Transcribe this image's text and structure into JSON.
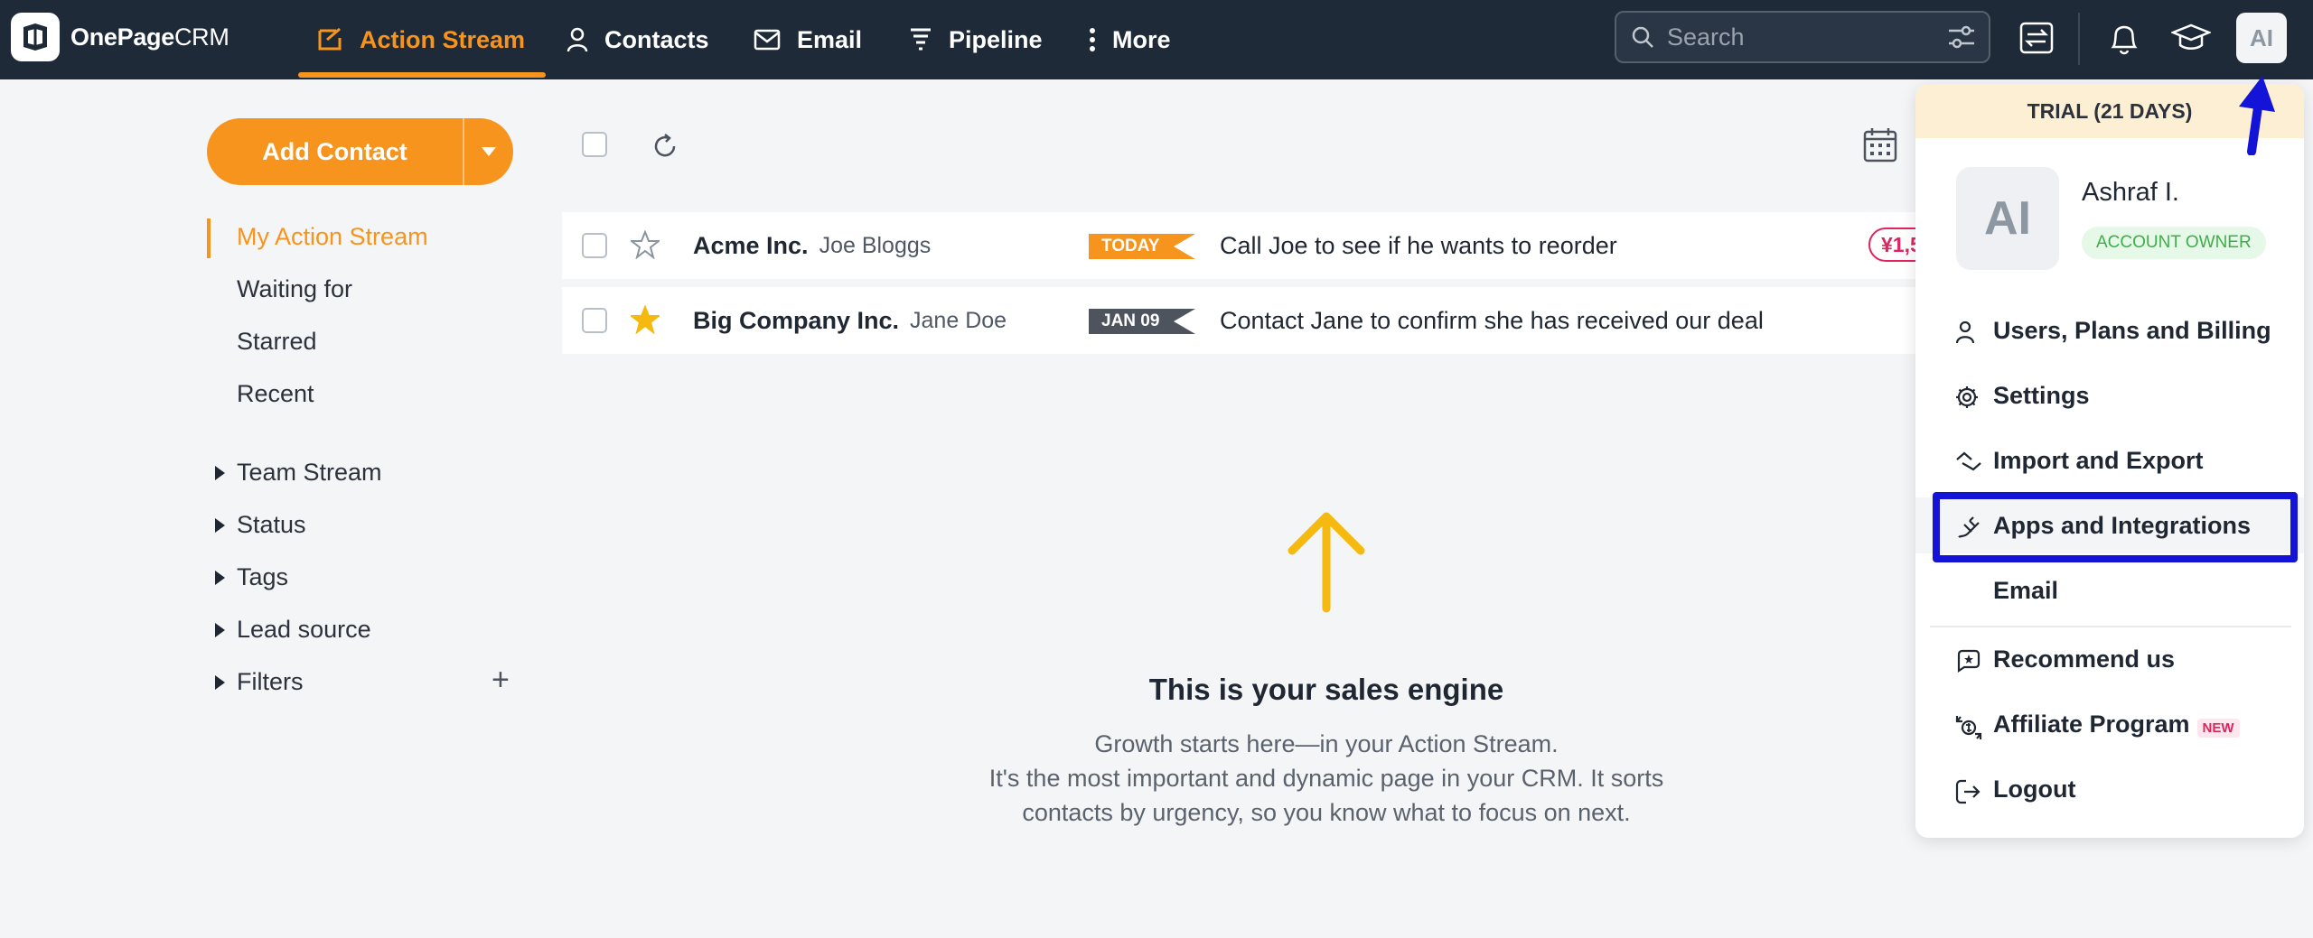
{
  "app": {
    "logo_bold": "OnePage",
    "logo_thin": "CRM"
  },
  "nav": {
    "action_stream": "Action Stream",
    "contacts": "Contacts",
    "email": "Email",
    "pipeline": "Pipeline",
    "more": "More"
  },
  "search": {
    "placeholder": "Search"
  },
  "user": {
    "initials": "AI",
    "name": "Ashraf I.",
    "role": "ACCOUNT OWNER",
    "trial": "TRIAL (21 DAYS)"
  },
  "sidebar": {
    "add_contact": "Add Contact",
    "views": [
      "My Action Stream",
      "Waiting for",
      "Starred",
      "Recent"
    ],
    "groups": [
      "Team Stream",
      "Status",
      "Tags",
      "Lead source",
      "Filters"
    ]
  },
  "rows": [
    {
      "company": "Acme Inc.",
      "person": "Joe Bloggs",
      "tag": "TODAY",
      "action": "Call Joe to see if he wants to reorder",
      "starred": false,
      "deal": "¥1,5"
    },
    {
      "company": "Big Company Inc.",
      "person": "Jane Doe",
      "tag": "JAN 09",
      "action": "Contact Jane to confirm she has received our deal",
      "starred": true
    }
  ],
  "empty": {
    "title": "This is your sales engine",
    "line1": "Growth starts here—in your Action Stream.",
    "line2": "It's the most important and dynamic page in your CRM. It sorts",
    "line3": "contacts by urgency, so you know what to focus on next."
  },
  "menu": {
    "users": "Users, Plans and Billing",
    "settings": "Settings",
    "import": "Import and Export",
    "apps": "Apps and Integrations",
    "email": "Email",
    "recommend": "Recommend us",
    "affiliate": "Affiliate Program",
    "affiliate_badge": "NEW",
    "logout": "Logout"
  },
  "colors": {
    "accent": "#f7941d",
    "nav_bg": "#1e2a38",
    "highlight": "#1414d8",
    "success": "#3fae4a"
  }
}
